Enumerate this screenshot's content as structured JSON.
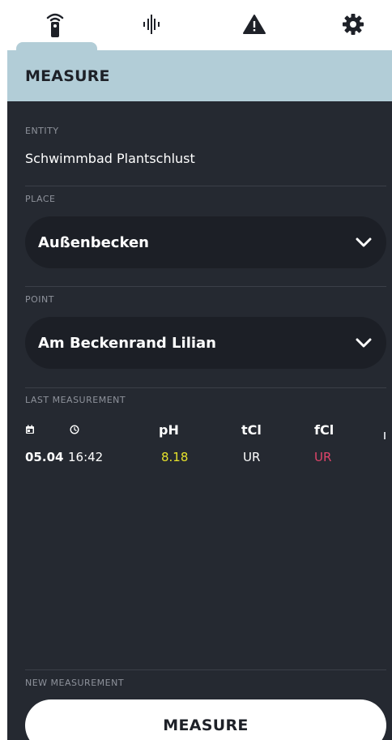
{
  "tabs": [
    {
      "icon": "remote-icon"
    },
    {
      "icon": "waveform-icon"
    },
    {
      "icon": "warning-icon"
    },
    {
      "icon": "gear-icon"
    }
  ],
  "header": {
    "title": "MEASURE"
  },
  "entity": {
    "label": "ENTITY",
    "value": "Schwimmbad Plantschlust"
  },
  "place": {
    "label": "PLACE",
    "selected": "Außenbecken"
  },
  "point": {
    "label": "POINT",
    "selected": "Am Beckenrand Lilian"
  },
  "last_measurement": {
    "label": "LAST MEASUREMENT",
    "columns": {
      "ph": "pH",
      "tcl": "tCl",
      "fcl": "fCl"
    },
    "row": {
      "date": "05.04",
      "time": "16:42",
      "ph": "8.18",
      "tcl": "UR",
      "fcl": "UR"
    },
    "colors": {
      "ph": "#e6e12b",
      "tcl": "#ffffff",
      "fcl": "#e0446a"
    }
  },
  "new_measurement": {
    "label": "NEW MEASUREMENT",
    "button": "MEASURE"
  },
  "colors": {
    "header": "#b2cdd7",
    "background": "#252931",
    "field": "#1c1f26"
  }
}
